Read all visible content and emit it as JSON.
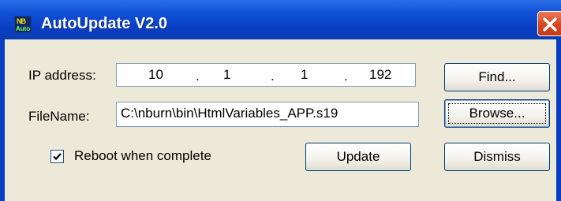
{
  "window": {
    "title": "AutoUpdate V2.0",
    "icon": "app-logo-icon",
    "icon_text_top": "NB",
    "icon_text_bottom": "Auto",
    "close_icon": "close-icon"
  },
  "form": {
    "ip_label": "IP address:",
    "ip_octets": [
      "10",
      "1",
      "1",
      "192"
    ],
    "ip_separator": ".",
    "filename_label": "FileName:",
    "filename_value": "C:\\nburn\\bin\\HtmlVariables_APP.s19",
    "reboot_label": "Reboot when complete",
    "reboot_checked": true
  },
  "buttons": {
    "find": "Find...",
    "browse": "Browse...",
    "update": "Update",
    "dismiss": "Dismiss"
  },
  "colors": {
    "titlebar": "#0a3fc4",
    "dialog_bg": "#ece9d8",
    "close_button": "#d7461f",
    "button_border": "#003c74"
  }
}
